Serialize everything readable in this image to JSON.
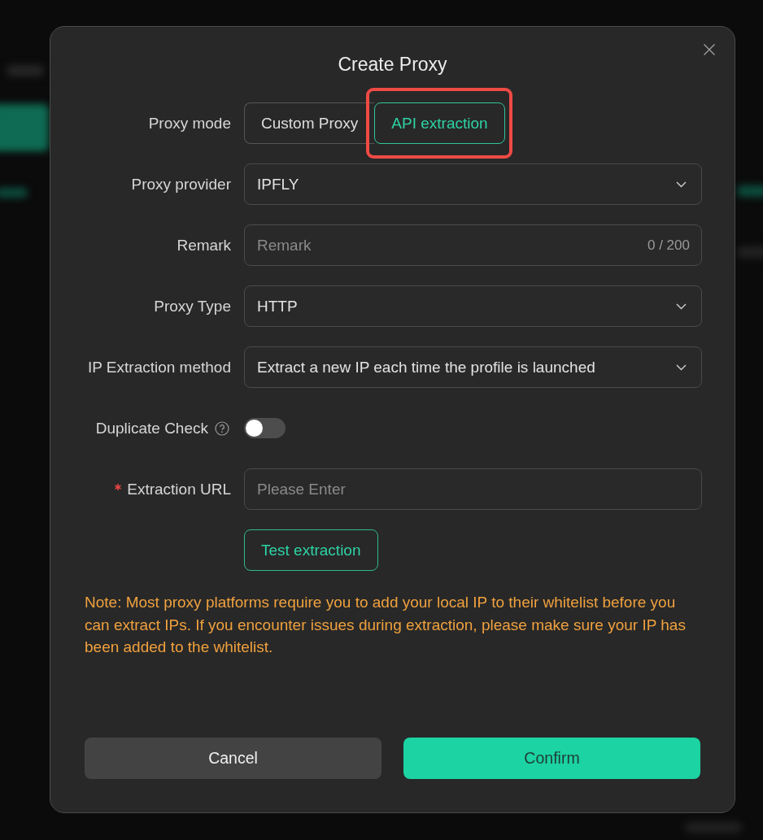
{
  "dialog": {
    "title": "Create Proxy"
  },
  "form": [
    {
      "kind": "segmented",
      "label": "Proxy mode",
      "required": false,
      "help": false,
      "options": [
        {
          "label": "Custom Proxy",
          "selected": false,
          "highlighted": false
        },
        {
          "label": "API extraction",
          "selected": true,
          "highlighted": true
        }
      ]
    },
    {
      "kind": "select",
      "label": "Proxy provider",
      "required": false,
      "help": false,
      "value": "IPFLY"
    },
    {
      "kind": "text",
      "label": "Remark",
      "required": false,
      "help": false,
      "placeholder": "Remark",
      "counter": "0 / 200"
    },
    {
      "kind": "select",
      "label": "Proxy Type",
      "required": false,
      "help": false,
      "value": "HTTP"
    },
    {
      "kind": "select",
      "label": "IP Extraction method",
      "required": false,
      "help": false,
      "value": "Extract a new IP each time the profile is launched"
    },
    {
      "kind": "toggle",
      "label": "Duplicate Check",
      "required": false,
      "help": true,
      "on": false
    },
    {
      "kind": "text",
      "label": "Extraction URL",
      "required": true,
      "help": false,
      "placeholder": "Please Enter"
    }
  ],
  "test_button": {
    "label": "Test extraction"
  },
  "note": "Note: Most proxy platforms require you to add your local IP to their whitelist before you can extract IPs. If you encounter issues during extraction, please make sure your IP has been added to the whitelist.",
  "buttons": [
    {
      "label": "Cancel",
      "kind": "secondary"
    },
    {
      "label": "Confirm",
      "kind": "primary"
    }
  ]
}
